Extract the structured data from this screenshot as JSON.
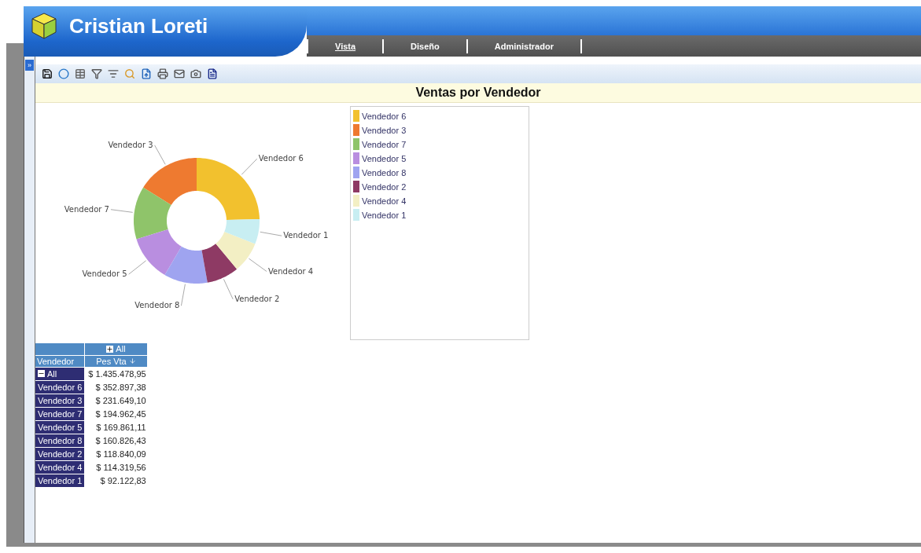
{
  "header": {
    "title": "Cristian Loreti"
  },
  "nav": [
    {
      "label": "Vista",
      "selected": true
    },
    {
      "label": "Diseño",
      "selected": false
    },
    {
      "label": "Administrador",
      "selected": false
    }
  ],
  "sidebar_toggle": "»",
  "report": {
    "title": "Ventas por Vendedor"
  },
  "chart_data": {
    "type": "donut",
    "categories": [
      "Vendedor 6",
      "Vendedor 3",
      "Vendedor 7",
      "Vendedor 5",
      "Vendedor 8",
      "Vendedor 2",
      "Vendedor 4",
      "Vendedor 1"
    ],
    "series": [
      {
        "name": "Pes Vta",
        "colors": [
          "#f2c12e",
          "#ee7a30",
          "#8fc46a",
          "#b98ee0",
          "#9fa4f0",
          "#8e3a64",
          "#f3efc4",
          "#c8eef2"
        ],
        "values": [
          24.584,
          16.137,
          13.582,
          11.833,
          11.204,
          8.279,
          7.964,
          6.417
        ]
      }
    ]
  },
  "legend": [
    {
      "label": "Vendedor 6",
      "color": "#f2c12e"
    },
    {
      "label": "Vendedor 3",
      "color": "#ee7a30"
    },
    {
      "label": "Vendedor 7",
      "color": "#8fc46a"
    },
    {
      "label": "Vendedor 5",
      "color": "#b98ee0"
    },
    {
      "label": "Vendedor 8",
      "color": "#9fa4f0"
    },
    {
      "label": "Vendedor 2",
      "color": "#8e3a64"
    },
    {
      "label": "Vendedor 4",
      "color": "#f3efc4"
    },
    {
      "label": "Vendedor 1",
      "color": "#c8eef2"
    }
  ],
  "table": {
    "column_group": "All",
    "row_header": "Vendedor",
    "total": {
      "label": "All",
      "value": "$ 1.435.478,95"
    },
    "rows": [
      {
        "label": "Vendedor 6",
        "value": "$ 352.897,38"
      },
      {
        "label": "Vendedor 3",
        "value": "$ 231.649,10"
      },
      {
        "label": "Vendedor 7",
        "value": "$ 194.962,45"
      },
      {
        "label": "Vendedor 5",
        "value": "$ 169.861,11"
      },
      {
        "label": "Vendedor 8",
        "value": "$ 160.826,43"
      },
      {
        "label": "Vendedor 2",
        "value": "$ 118.840,09"
      },
      {
        "label": "Vendedor 4",
        "value": "$ 114.319,56"
      },
      {
        "label": "Vendedor 1",
        "value": "$ 92.122,83"
      }
    ]
  }
}
